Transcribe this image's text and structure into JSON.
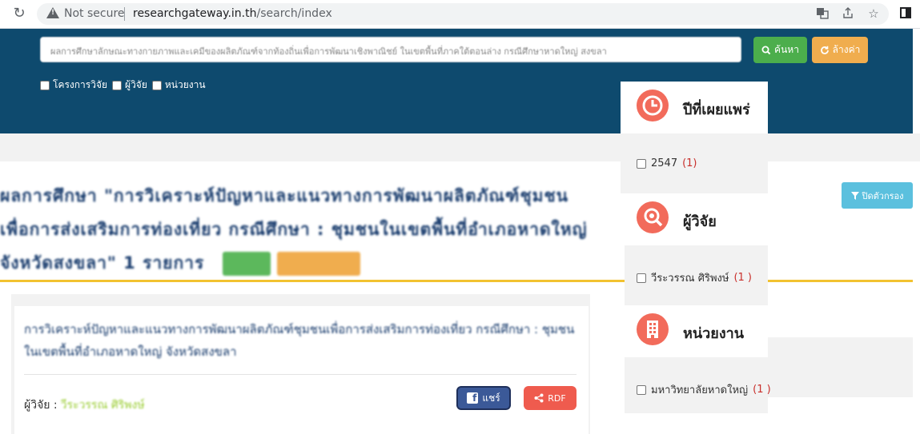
{
  "browser": {
    "security_label": "Not secure",
    "url_host": "researchgateway.in.th",
    "url_path": "/search/index"
  },
  "search": {
    "query_value": "ผลการศึกษาลักษณะทางกายภาพและเคมีของผลิตภัณฑ์จากท้องถิ่นเพื่อการพัฒนาเชิงพาณิชย์ ในเขตพื้นที่ภาคใต้ตอนล่าง กรณีศึกษาหาดใหญ่ สงขลา",
    "search_label": "ค้นหา",
    "reset_label": "ล้างค่า",
    "filters": [
      "โครงการวิจัย",
      "ผู้วิจัย",
      "หน่วยงาน"
    ]
  },
  "page": {
    "title": "ผลการศึกษา \"การวิเคราะห์ปัญหาและแนวทางการพัฒนาผลิตภัณฑ์ชุมชนเพื่อการส่งเสริมการท่องเที่ยว กรณีศึกษา : ชุมชนในเขตพื้นที่อำเภอหาดใหญ่ จังหวัดสงขลา\" 1 รายการ",
    "filter_close_label": "ปิดตัวกรอง"
  },
  "result": {
    "title": "การวิเคราะห์ปัญหาและแนวทางการพัฒนาผลิตภัณฑ์ชุมชนเพื่อการส่งเสริมการท่องเที่ยว กรณีศึกษา : ชุมชนในเขตพื้นที่อำเภอหาดใหญ่ จังหวัดสงขลา",
    "researcher_label": "ผู้วิจัย :",
    "researcher_name": "วีระวรรณ ศิริพงษ์",
    "share_label": "แชร์",
    "rdf_label": "RDF"
  },
  "facets": [
    {
      "title": "ปีที่เผยแพร่",
      "icon": "clock-icon",
      "item": "2547",
      "count": "(1)"
    },
    {
      "title": "ผู้วิจัย",
      "icon": "eye-search-icon",
      "item": "วีระวรรณ ศิริพงษ์",
      "count": "(1 )"
    },
    {
      "title": "หน่วยงาน",
      "icon": "building-icon",
      "item": "มหาวิทยาลัยหาดใหญ่",
      "count": "(1 )"
    }
  ],
  "colors": {
    "header_band": "#0e4a6e",
    "search_button": "#4cae4c",
    "reset_button": "#f0ad4e",
    "facet_icon": "#f26b5b",
    "accent_line": "#f2c230",
    "filter_button": "#5bc0de"
  }
}
